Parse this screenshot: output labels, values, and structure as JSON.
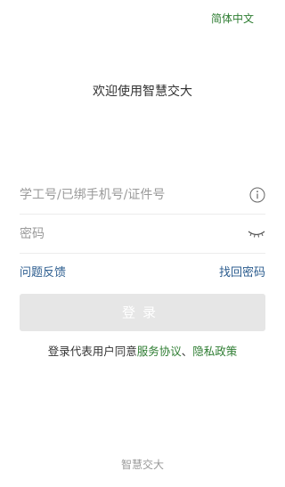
{
  "header": {
    "language_label": "简体中文"
  },
  "welcome": {
    "title": "欢迎使用智慧交大"
  },
  "form": {
    "account_placeholder": "学工号/已绑手机号/证件号",
    "account_value": "",
    "password_placeholder": "密码",
    "password_value": "",
    "info_icon": "info-circle",
    "eye_icon": "eye-closed"
  },
  "links": {
    "feedback": "问题反馈",
    "forgot_password": "找回密码"
  },
  "login_button": {
    "label": "登录",
    "enabled": false
  },
  "agreement": {
    "prefix": "登录代表用户同意",
    "service_agreement": "服务协议",
    "separator": "、",
    "privacy_policy": "隐私政策"
  },
  "footer": {
    "brand": "智慧交大"
  },
  "colors": {
    "accent_green": "#2e7d32",
    "link_blue": "#2c5d8f",
    "button_disabled": "#e6e6e6"
  }
}
